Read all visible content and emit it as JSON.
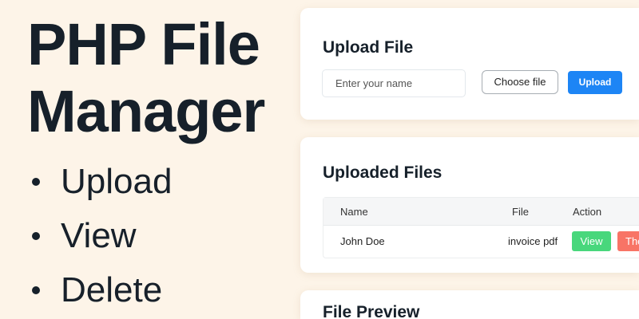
{
  "hero": {
    "title_line1": "PHP File",
    "title_line2": "Manager",
    "features": [
      "Upload",
      "View",
      "Delete"
    ]
  },
  "upload_card": {
    "title": "Upload File",
    "name_placeholder": "Enter your name",
    "choose_label": "Choose file",
    "upload_label": "Upload"
  },
  "files_card": {
    "title": "Uploaded Files",
    "columns": [
      "Name",
      "File",
      "Action"
    ],
    "rows": [
      {
        "name": "John Doe",
        "file": "invoice pdf",
        "view_label": "View",
        "delete_label": "The"
      }
    ]
  },
  "preview_card": {
    "title": "File Preview"
  },
  "colors": {
    "primary": "#1d85f5",
    "success": "#48d77c",
    "danger": "#f87466",
    "background": "#fdf4e8"
  }
}
